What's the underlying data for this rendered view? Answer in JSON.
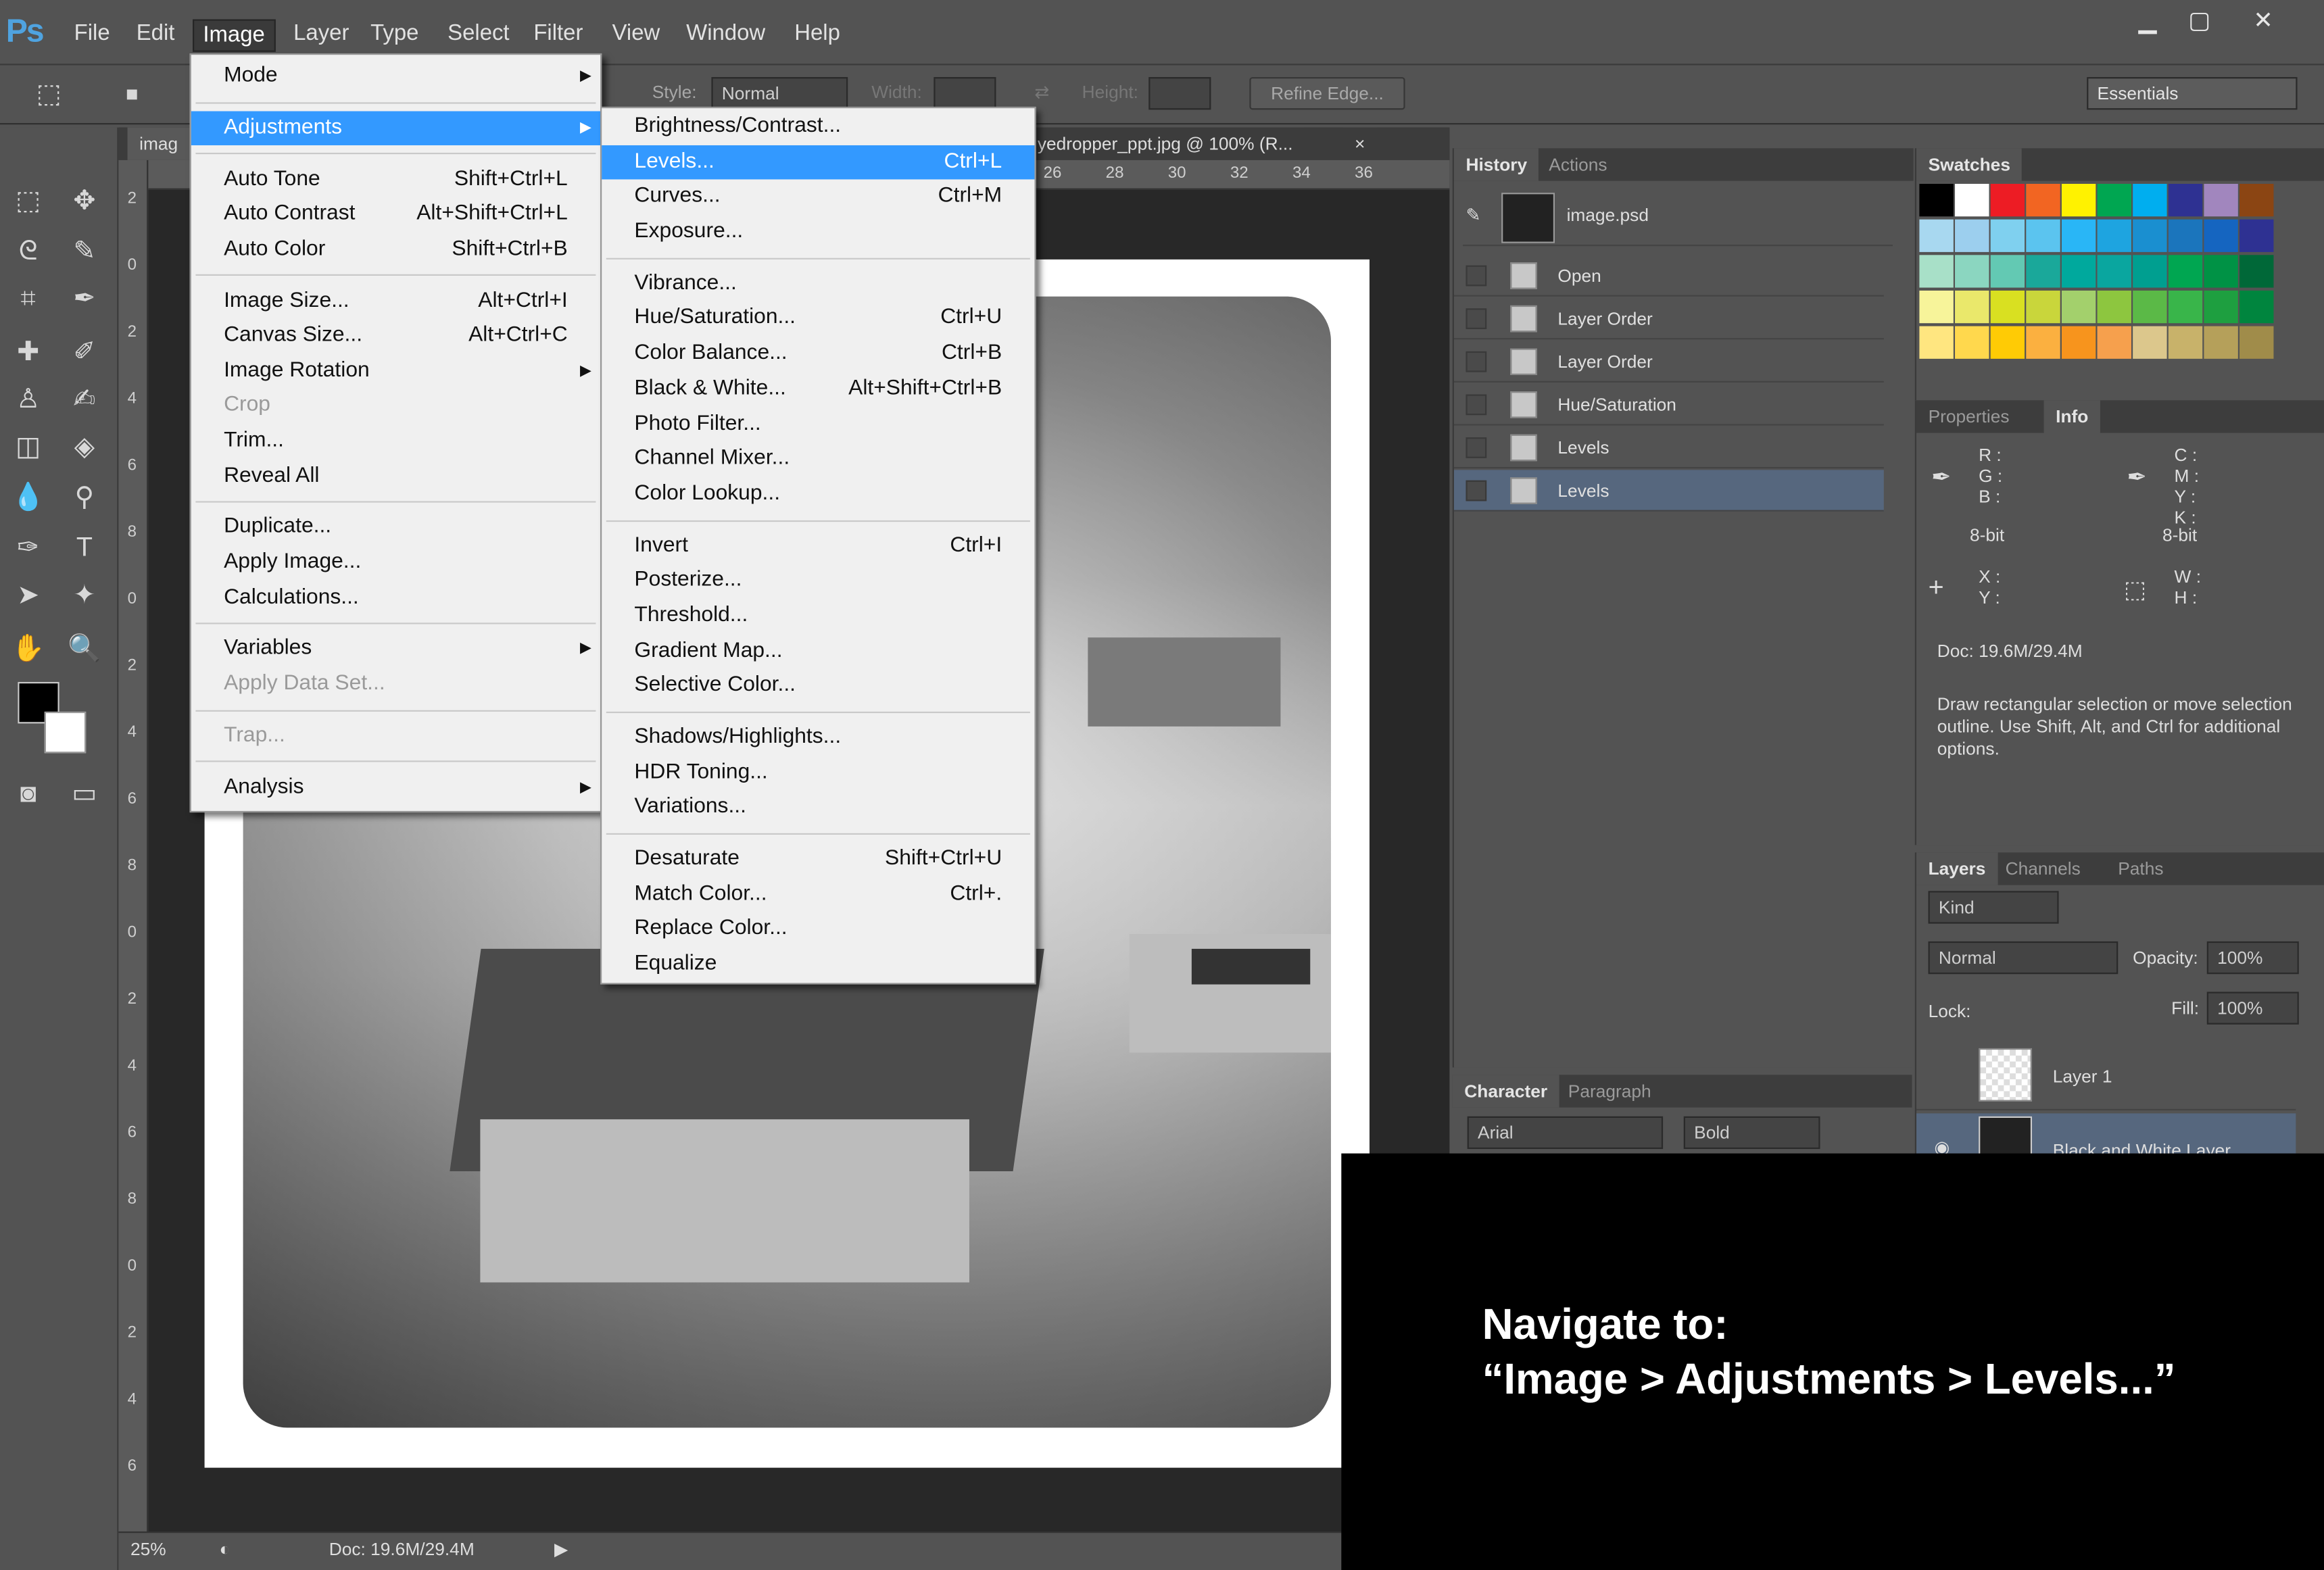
{
  "app": {
    "logo": "Ps"
  },
  "menubar": {
    "items": [
      "File",
      "Edit",
      "Image",
      "Layer",
      "Type",
      "Select",
      "Filter",
      "View",
      "Window",
      "Help"
    ],
    "active": "Image",
    "window_buttons": [
      "▁",
      "▢",
      "✕"
    ]
  },
  "options_bar": {
    "style_label": "Style:",
    "style_value": "Normal",
    "width_label": "Width:",
    "height_label": "Height:",
    "refine_edge": "Refine Edge...",
    "workspace": "Essentials"
  },
  "document": {
    "tab_left": "imag",
    "tab_title": "yedropper_ppt.jpg @ 100% (R...",
    "tab_close": "×",
    "ruler_top": [
      "26",
      "28",
      "30",
      "32",
      "34",
      "36"
    ],
    "ruler_left": [
      "2",
      "0",
      "2",
      "4",
      "6",
      "8",
      "0",
      "2",
      "4",
      "6",
      "8",
      "0",
      "2",
      "4",
      "6",
      "8",
      "0",
      "2",
      "4",
      "6"
    ],
    "zoom": "25%",
    "doc_size": "Doc: 19.6M/29.4M"
  },
  "image_menu": {
    "items": [
      {
        "label": "Mode",
        "shortcut": "",
        "submenu": true
      },
      {
        "sep": true
      },
      {
        "label": "Adjustments",
        "shortcut": "",
        "submenu": true,
        "highlight": true
      },
      {
        "sep": true
      },
      {
        "label": "Auto Tone",
        "shortcut": "Shift+Ctrl+L"
      },
      {
        "label": "Auto Contrast",
        "shortcut": "Alt+Shift+Ctrl+L"
      },
      {
        "label": "Auto Color",
        "shortcut": "Shift+Ctrl+B"
      },
      {
        "sep": true
      },
      {
        "label": "Image Size...",
        "shortcut": "Alt+Ctrl+I"
      },
      {
        "label": "Canvas Size...",
        "shortcut": "Alt+Ctrl+C"
      },
      {
        "label": "Image Rotation",
        "shortcut": "",
        "submenu": true
      },
      {
        "label": "Crop",
        "shortcut": "",
        "disabled": true
      },
      {
        "label": "Trim...",
        "shortcut": ""
      },
      {
        "label": "Reveal All",
        "shortcut": ""
      },
      {
        "sep": true
      },
      {
        "label": "Duplicate...",
        "shortcut": ""
      },
      {
        "label": "Apply Image...",
        "shortcut": ""
      },
      {
        "label": "Calculations...",
        "shortcut": ""
      },
      {
        "sep": true
      },
      {
        "label": "Variables",
        "shortcut": "",
        "submenu": true
      },
      {
        "label": "Apply Data Set...",
        "shortcut": "",
        "disabled": true
      },
      {
        "sep": true
      },
      {
        "label": "Trap...",
        "shortcut": "",
        "disabled": true
      },
      {
        "sep": true
      },
      {
        "label": "Analysis",
        "shortcut": "",
        "submenu": true
      }
    ]
  },
  "adjustments_menu": {
    "items": [
      {
        "label": "Brightness/Contrast...",
        "shortcut": ""
      },
      {
        "label": "Levels...",
        "shortcut": "Ctrl+L",
        "highlight": true
      },
      {
        "label": "Curves...",
        "shortcut": "Ctrl+M"
      },
      {
        "label": "Exposure...",
        "shortcut": ""
      },
      {
        "sep": true
      },
      {
        "label": "Vibrance...",
        "shortcut": ""
      },
      {
        "label": "Hue/Saturation...",
        "shortcut": "Ctrl+U"
      },
      {
        "label": "Color Balance...",
        "shortcut": "Ctrl+B"
      },
      {
        "label": "Black & White...",
        "shortcut": "Alt+Shift+Ctrl+B"
      },
      {
        "label": "Photo Filter...",
        "shortcut": ""
      },
      {
        "label": "Channel Mixer...",
        "shortcut": ""
      },
      {
        "label": "Color Lookup...",
        "shortcut": ""
      },
      {
        "sep": true
      },
      {
        "label": "Invert",
        "shortcut": "Ctrl+I"
      },
      {
        "label": "Posterize...",
        "shortcut": ""
      },
      {
        "label": "Threshold...",
        "shortcut": ""
      },
      {
        "label": "Gradient Map...",
        "shortcut": ""
      },
      {
        "label": "Selective Color...",
        "shortcut": ""
      },
      {
        "sep": true
      },
      {
        "label": "Shadows/Highlights...",
        "shortcut": ""
      },
      {
        "label": "HDR Toning...",
        "shortcut": ""
      },
      {
        "label": "Variations...",
        "shortcut": ""
      },
      {
        "sep": true
      },
      {
        "label": "Desaturate",
        "shortcut": "Shift+Ctrl+U"
      },
      {
        "label": "Match Color...",
        "shortcut": "Ctrl+."
      },
      {
        "label": "Replace Color...",
        "shortcut": ""
      },
      {
        "label": "Equalize",
        "shortcut": ""
      }
    ]
  },
  "history_panel": {
    "tabs": [
      "History",
      "Actions"
    ],
    "snapshot": "image.psd",
    "steps": [
      "Open",
      "Layer Order",
      "Layer Order",
      "Hue/Saturation",
      "Levels",
      "Levels"
    ],
    "selected_index": 5
  },
  "swatches_panel": {
    "tab": "Swatches",
    "colors": [
      "#000000",
      "#ffffff",
      "#ed1c24",
      "#f26522",
      "#fff200",
      "#00a651",
      "#00aeef",
      "#2e3192",
      "#a186be",
      "#8b4513",
      "#a8d8f0",
      "#9ccfee",
      "#7fd0ef",
      "#5bc4ef",
      "#29b6f6",
      "#1ea4e0",
      "#1a8fd0",
      "#1b75bc",
      "#1565c0",
      "#2e3192",
      "#a8e0c8",
      "#8bd6c0",
      "#63c9b3",
      "#1aa89a",
      "#00a99d",
      "#0aa69f",
      "#009f90",
      "#00a651",
      "#009245",
      "#006838",
      "#f7f49a",
      "#eae86b",
      "#d9e021",
      "#c9d63b",
      "#a3d06c",
      "#8dc63f",
      "#5bb947",
      "#39b54a",
      "#1e9f40",
      "#00853e",
      "#ffe680",
      "#ffd84d",
      "#ffcb05",
      "#fbb040",
      "#f7941d",
      "#f6a04d",
      "#dcc78c",
      "#c8b26a",
      "#b5a05a",
      "#a08c4a"
    ]
  },
  "info_panel": {
    "tabs": [
      "Properties",
      "Info"
    ],
    "rgb": [
      "R :",
      "G :",
      "B :"
    ],
    "cmyk": [
      "C :",
      "M :",
      "Y :",
      "K :"
    ],
    "bit_left": "8-bit",
    "bit_right": "8-bit",
    "xy": [
      "X :",
      "Y :"
    ],
    "wh": [
      "W :",
      "H :"
    ],
    "doc": "Doc: 19.6M/29.4M",
    "hint": "Draw rectangular selection or move selection outline.  Use Shift, Alt, and Ctrl for additional options."
  },
  "layers_panel": {
    "tabs": [
      "Layers",
      "Channels",
      "Paths"
    ],
    "kind": "Kind",
    "blend": "Normal",
    "opacity_label": "Opacity:",
    "opacity": "100%",
    "lock_label": "Lock:",
    "fill_label": "Fill:",
    "fill": "100%",
    "layers": [
      "Layer 1",
      "Black and White Layer"
    ]
  },
  "character_panel": {
    "tabs": [
      "Character",
      "Paragraph"
    ],
    "font": "Arial",
    "style": "Bold"
  },
  "overlay": {
    "line1": "Navigate to:",
    "line2": "“Image > Adjustments > Levels...”"
  }
}
